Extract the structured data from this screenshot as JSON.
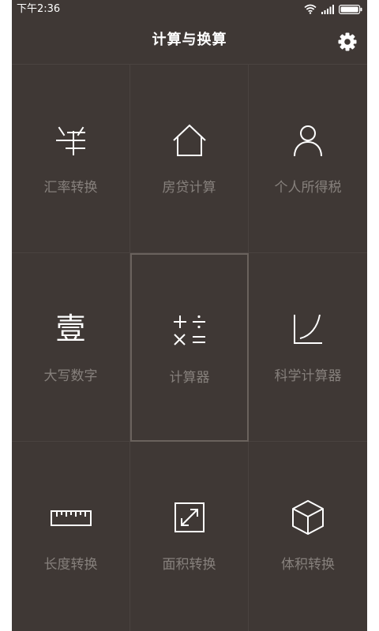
{
  "status_bar": {
    "time": "下午2:36",
    "icons": [
      "wifi-icon",
      "signal-icon",
      "battery-icon"
    ]
  },
  "header": {
    "title": "计算与换算",
    "settings_icon": "gear-icon"
  },
  "tiles": [
    {
      "label": "汇率转换",
      "icon": "yuan-icon"
    },
    {
      "label": "房贷计算",
      "icon": "house-icon"
    },
    {
      "label": "个人所得税",
      "icon": "person-icon"
    },
    {
      "label": "大写数字",
      "icon": "chinese-numeral-icon",
      "glyph": "壹"
    },
    {
      "label": "计算器",
      "icon": "calculator-icon",
      "selected": true
    },
    {
      "label": "科学计算器",
      "icon": "curve-graph-icon"
    },
    {
      "label": "长度转换",
      "icon": "ruler-icon"
    },
    {
      "label": "面积转换",
      "icon": "expand-arrows-icon"
    },
    {
      "label": "体积转换",
      "icon": "cube-icon"
    }
  ],
  "colors": {
    "background": "#3f3835",
    "grid_line": "#4a4340",
    "label": "#86807c",
    "icon": "#ffffff",
    "title": "#ffffff"
  }
}
